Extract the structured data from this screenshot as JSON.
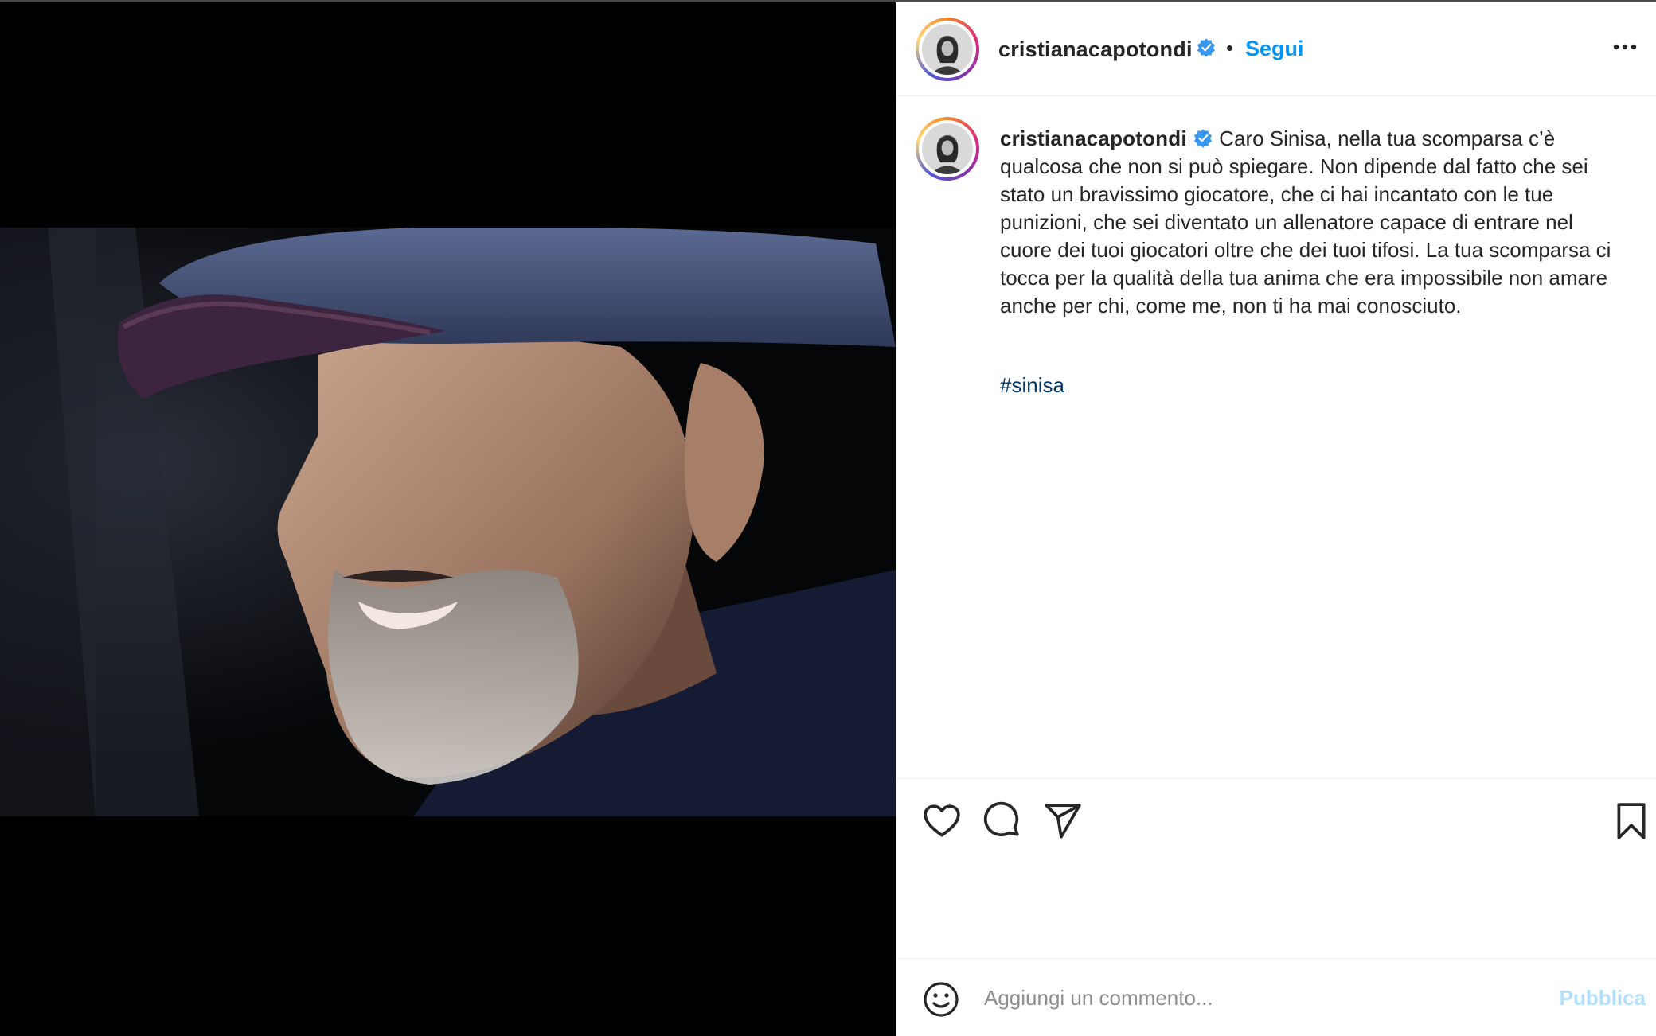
{
  "post": {
    "username": "cristianacapotondi",
    "verified_icon": "verified-badge-icon",
    "separator": "•",
    "follow_label": "Segui",
    "more_icon": "more-options-icon",
    "image_description_icon": "post-photo"
  },
  "caption": {
    "username": "cristianacapotondi",
    "text": "Caro Sinisa, nella tua scomparsa c’è qualcosa che non si può spiegare. Non dipende dal fatto che sei stato un bravissimo giocatore, che ci hai incantato con le tue punizioni, che sei diventato un allenatore capace di entrare nel cuore dei tuoi giocatori oltre che dei tuoi tifosi. La tua scomparsa ci tocca per la qualità della tua anima che era impossibile non amare anche per chi, come me, non ti ha mai conosciuto.",
    "hashtag": "#sinisa"
  },
  "actions": {
    "like_icon": "heart-icon",
    "comment_icon": "comment-icon",
    "share_icon": "send-icon",
    "save_icon": "bookmark-icon"
  },
  "comment": {
    "emoji_icon": "smiley-icon",
    "placeholder": "Aggiungi un commento...",
    "publish_label": "Pubblica"
  },
  "colors": {
    "link_blue": "#0095f6",
    "hashtag_blue": "#00376b",
    "publish_disabled": "#b2dffc",
    "text": "#262626",
    "muted": "#8e8e8e"
  }
}
